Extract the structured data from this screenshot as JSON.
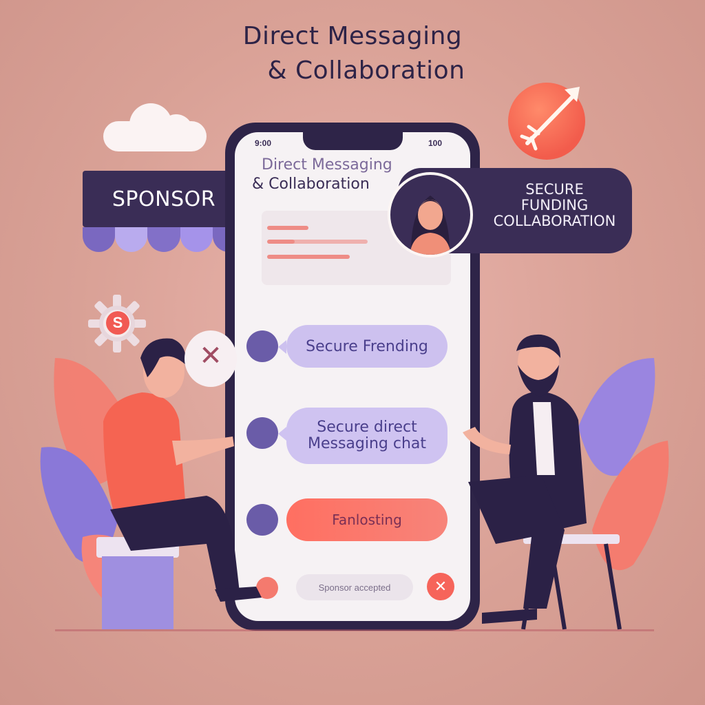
{
  "headline": {
    "line1": "Direct Messaging",
    "line2": "& Collaboration"
  },
  "sponsor_banner": {
    "label": "SPONSOR"
  },
  "profile_banner": {
    "line1": "SECURE",
    "line2": "FUNDING",
    "line3": "COLLABORATION"
  },
  "phone": {
    "status_left": "9:00",
    "status_right": "100",
    "screen_title_1": "Direct Messaging",
    "screen_title_2": "& Collaboration",
    "messages": [
      {
        "text": "Secure Frending"
      },
      {
        "text": "Secure direct Messaging chat"
      },
      {
        "text": "Fanlosting"
      }
    ],
    "input_text": "Sponsor accepted",
    "close_glyph": "✕"
  },
  "speech_glyph": "✕",
  "gear_letter": "S",
  "colors": {
    "navy": "#3a2d56",
    "accent_purple": "#6a5ca8",
    "bubble_purple": "#cdc1ef",
    "coral": "#f6645a",
    "background": "#d9a196"
  },
  "icons": [
    "cloud-icon",
    "rocket-badge-icon",
    "gear-dollar-icon",
    "speech-bubble-icon",
    "avatar-icon"
  ]
}
